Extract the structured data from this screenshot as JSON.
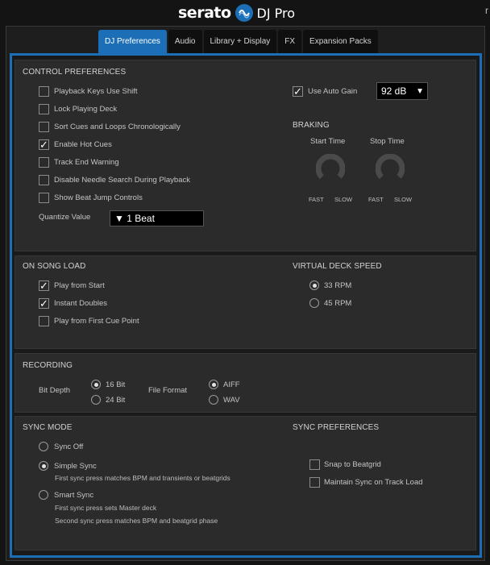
{
  "app": {
    "logo_text": "serato",
    "logo_suffix": "DJ Pro",
    "corner_mark": "r"
  },
  "tabs": [
    {
      "label": "DJ Preferences",
      "active": true
    },
    {
      "label": "Audio"
    },
    {
      "label": "Library + Display"
    },
    {
      "label": "FX"
    },
    {
      "label": "Expansion Packs"
    }
  ],
  "control": {
    "heading": "CONTROL PREFERENCES",
    "options": [
      {
        "label": "Playback Keys Use Shift",
        "checked": false
      },
      {
        "label": "Lock Playing Deck",
        "checked": false
      },
      {
        "label": "Sort Cues and Loops Chronologically",
        "checked": false
      },
      {
        "label": "Enable Hot Cues",
        "checked": true
      },
      {
        "label": "Track End Warning",
        "checked": false
      },
      {
        "label": "Disable Needle Search During Playback",
        "checked": false
      },
      {
        "label": "Show Beat Jump Controls",
        "checked": false
      }
    ],
    "quantize_label": "Quantize Value",
    "quantize_value": "▼ 1 Beat",
    "auto_gain_label": "Use Auto Gain",
    "auto_gain_checked": true,
    "auto_gain_value": "92 dB",
    "auto_gain_arrow": "▼",
    "braking_heading": "BRAKING",
    "start_time_label": "Start Time",
    "stop_time_label": "Stop Time",
    "fast_label": "FAST",
    "slow_label": "SLOW"
  },
  "song_load": {
    "heading": "ON SONG LOAD",
    "options": [
      {
        "label": "Play from Start",
        "checked": true
      },
      {
        "label": "Instant Doubles",
        "checked": true
      },
      {
        "label": "Play from First Cue Point",
        "checked": false
      }
    ],
    "vds_heading": "VIRTUAL DECK SPEED",
    "vds_options": [
      {
        "label": "33 RPM",
        "selected": true
      },
      {
        "label": "45 RPM",
        "selected": false
      }
    ]
  },
  "recording": {
    "heading": "RECORDING",
    "bit_depth_label": "Bit Depth",
    "bit_options": [
      {
        "label": "16 Bit",
        "selected": true
      },
      {
        "label": "24 Bit",
        "selected": false
      }
    ],
    "file_format_label": "File Format",
    "format_options": [
      {
        "label": "AIFF",
        "selected": true
      },
      {
        "label": "WAV",
        "selected": false
      }
    ]
  },
  "sync": {
    "heading": "SYNC MODE",
    "modes": [
      {
        "label": "Sync Off",
        "selected": false,
        "desc": []
      },
      {
        "label": "Simple Sync",
        "selected": true,
        "desc": [
          "First sync press matches BPM and transients or beatgrids"
        ]
      },
      {
        "label": "Smart Sync",
        "selected": false,
        "desc": [
          "First sync press sets Master deck",
          "Second sync press matches BPM and beatgrid phase"
        ]
      }
    ],
    "prefs_heading": "SYNC PREFERENCES",
    "prefs": [
      {
        "label": "Snap to Beatgrid",
        "checked": false
      },
      {
        "label": "Maintain Sync on Track Load",
        "checked": false
      }
    ]
  },
  "colors": {
    "accent": "#1c6fb7",
    "panel": "#2b2b2b",
    "background": "#141414"
  }
}
